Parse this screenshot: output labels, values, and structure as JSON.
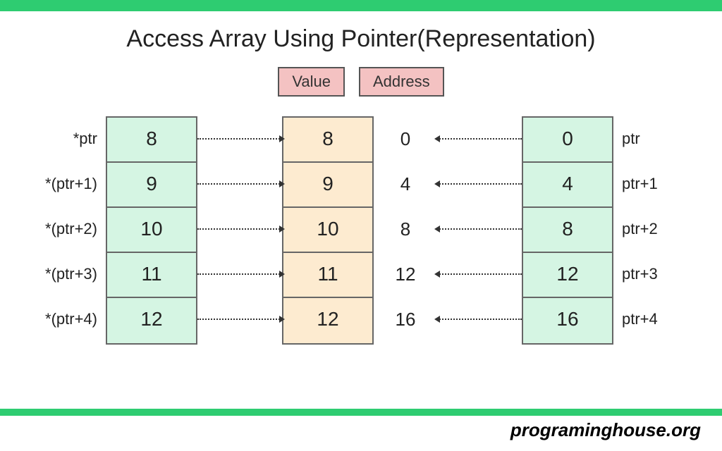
{
  "title": "Access Array Using Pointer(Representation)",
  "legend": {
    "value": "Value",
    "address": "Address"
  },
  "rows": [
    {
      "deref": "*ptr",
      "val": "8",
      "mid": "8",
      "addr": "0",
      "inc": "0",
      "ptr": "ptr"
    },
    {
      "deref": "*(ptr+1)",
      "val": "9",
      "mid": "9",
      "addr": "4",
      "inc": "4",
      "ptr": "ptr+1"
    },
    {
      "deref": "*(ptr+2)",
      "val": "10",
      "mid": "10",
      "addr": "8",
      "inc": "8",
      "ptr": "ptr+2"
    },
    {
      "deref": "*(ptr+3)",
      "val": "11",
      "mid": "11",
      "addr": "12",
      "inc": "12",
      "ptr": "ptr+3"
    },
    {
      "deref": "*(ptr+4)",
      "val": "12",
      "mid": "12",
      "addr": "16",
      "inc": "16",
      "ptr": "ptr+4"
    }
  ],
  "footer": "programinghouse.org"
}
